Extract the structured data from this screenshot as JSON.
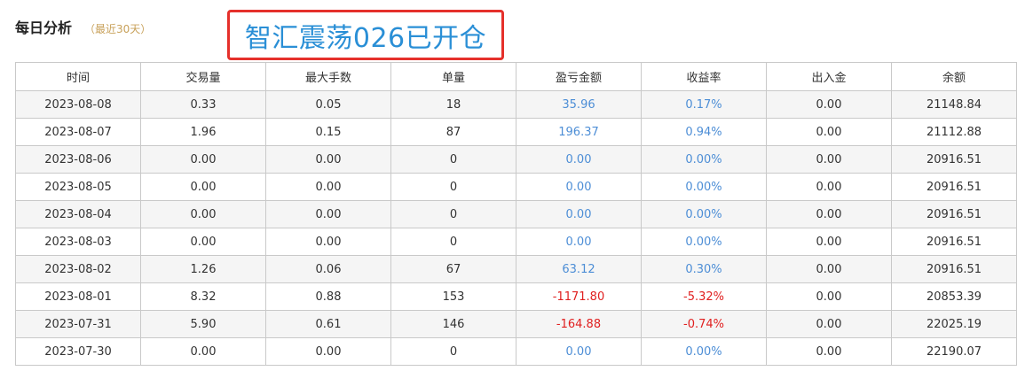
{
  "header": {
    "title": "每日分析",
    "subtitle": "（最近30天）"
  },
  "annotation": {
    "text": "智汇震荡026已开仓",
    "border_color": "#e5302b",
    "text_color": "#2a8fd6"
  },
  "table": {
    "columns": [
      "时间",
      "交易量",
      "最大手数",
      "单量",
      "盈亏金额",
      "收益率",
      "出入金",
      "余额"
    ],
    "rows": [
      {
        "date": "2023-08-08",
        "volume": "0.33",
        "max_lots": "0.05",
        "orders": "18",
        "pnl": "35.96",
        "return": "0.17%",
        "flow": "0.00",
        "balance": "21148.84",
        "pnl_sign": "pos"
      },
      {
        "date": "2023-08-07",
        "volume": "1.96",
        "max_lots": "0.15",
        "orders": "87",
        "pnl": "196.37",
        "return": "0.94%",
        "flow": "0.00",
        "balance": "21112.88",
        "pnl_sign": "pos"
      },
      {
        "date": "2023-08-06",
        "volume": "0.00",
        "max_lots": "0.00",
        "orders": "0",
        "pnl": "0.00",
        "return": "0.00%",
        "flow": "0.00",
        "balance": "20916.51",
        "pnl_sign": "pos"
      },
      {
        "date": "2023-08-05",
        "volume": "0.00",
        "max_lots": "0.00",
        "orders": "0",
        "pnl": "0.00",
        "return": "0.00%",
        "flow": "0.00",
        "balance": "20916.51",
        "pnl_sign": "pos"
      },
      {
        "date": "2023-08-04",
        "volume": "0.00",
        "max_lots": "0.00",
        "orders": "0",
        "pnl": "0.00",
        "return": "0.00%",
        "flow": "0.00",
        "balance": "20916.51",
        "pnl_sign": "pos"
      },
      {
        "date": "2023-08-03",
        "volume": "0.00",
        "max_lots": "0.00",
        "orders": "0",
        "pnl": "0.00",
        "return": "0.00%",
        "flow": "0.00",
        "balance": "20916.51",
        "pnl_sign": "pos"
      },
      {
        "date": "2023-08-02",
        "volume": "1.26",
        "max_lots": "0.06",
        "orders": "67",
        "pnl": "63.12",
        "return": "0.30%",
        "flow": "0.00",
        "balance": "20916.51",
        "pnl_sign": "pos"
      },
      {
        "date": "2023-08-01",
        "volume": "8.32",
        "max_lots": "0.88",
        "orders": "153",
        "pnl": "-1171.80",
        "return": "-5.32%",
        "flow": "0.00",
        "balance": "20853.39",
        "pnl_sign": "neg"
      },
      {
        "date": "2023-07-31",
        "volume": "5.90",
        "max_lots": "0.61",
        "orders": "146",
        "pnl": "-164.88",
        "return": "-0.74%",
        "flow": "0.00",
        "balance": "22025.19",
        "pnl_sign": "neg"
      },
      {
        "date": "2023-07-30",
        "volume": "0.00",
        "max_lots": "0.00",
        "orders": "0",
        "pnl": "0.00",
        "return": "0.00%",
        "flow": "0.00",
        "balance": "22190.07",
        "pnl_sign": "pos"
      }
    ]
  },
  "colors": {
    "positive": "#4d8ed6",
    "negative": "#e02020",
    "subtitle": "#c8a15a"
  }
}
